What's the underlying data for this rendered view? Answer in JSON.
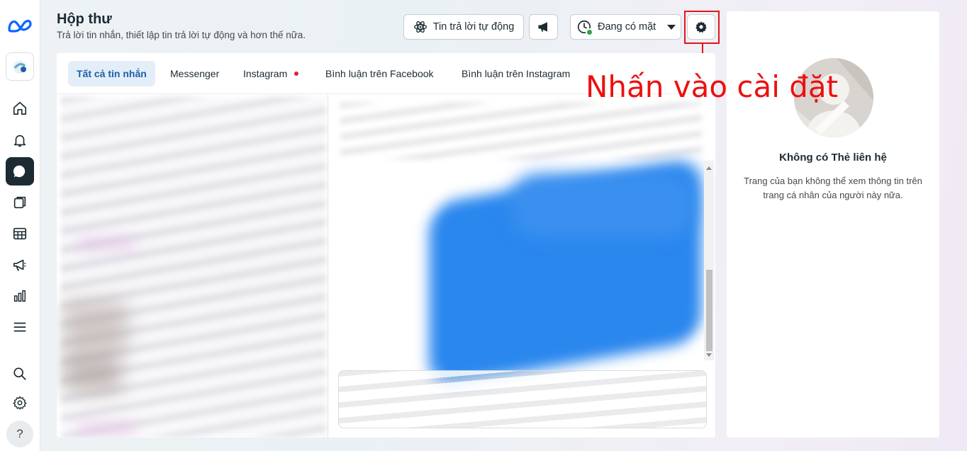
{
  "header": {
    "title": "Hộp thư",
    "subtitle": "Trả lời tin nhắn, thiết lập tin trả lời tự động và hơn thế nữa.",
    "auto_reply_label": "Tin trả lời tự động",
    "status_label": "Đang có mặt"
  },
  "tabs": [
    {
      "label": "Tất cả tin nhắn",
      "active": true
    },
    {
      "label": "Messenger"
    },
    {
      "label": "Instagram",
      "notification_dot": true
    },
    {
      "label": "Bình luận trên Facebook"
    },
    {
      "label": "Bình luận trên Instagram"
    }
  ],
  "annotation": {
    "text": "Nhấn vào cài đặt",
    "color": "#ee0f0f"
  },
  "right_panel": {
    "title": "Không có Thẻ liên hệ",
    "description": "Trang của bạn không thể xem thông tin trên trang cá nhân của người này nữa."
  },
  "left_nav": {
    "items": [
      "meta-logo",
      "page-avatar",
      "home-icon",
      "bell-icon",
      "chat-icon",
      "pages-icon",
      "table-icon",
      "megaphone-icon",
      "bar-chart-icon",
      "menu-icon",
      "search-icon",
      "settings-icon",
      "help-icon"
    ],
    "active": "chat-icon",
    "help_label": "?"
  },
  "colors": {
    "accent": "#1877f2",
    "active_tab_bg": "#e3eef9",
    "nav_active_bg": "#1c2b33",
    "highlight": "#e3141c",
    "online_green": "#31a24c"
  }
}
